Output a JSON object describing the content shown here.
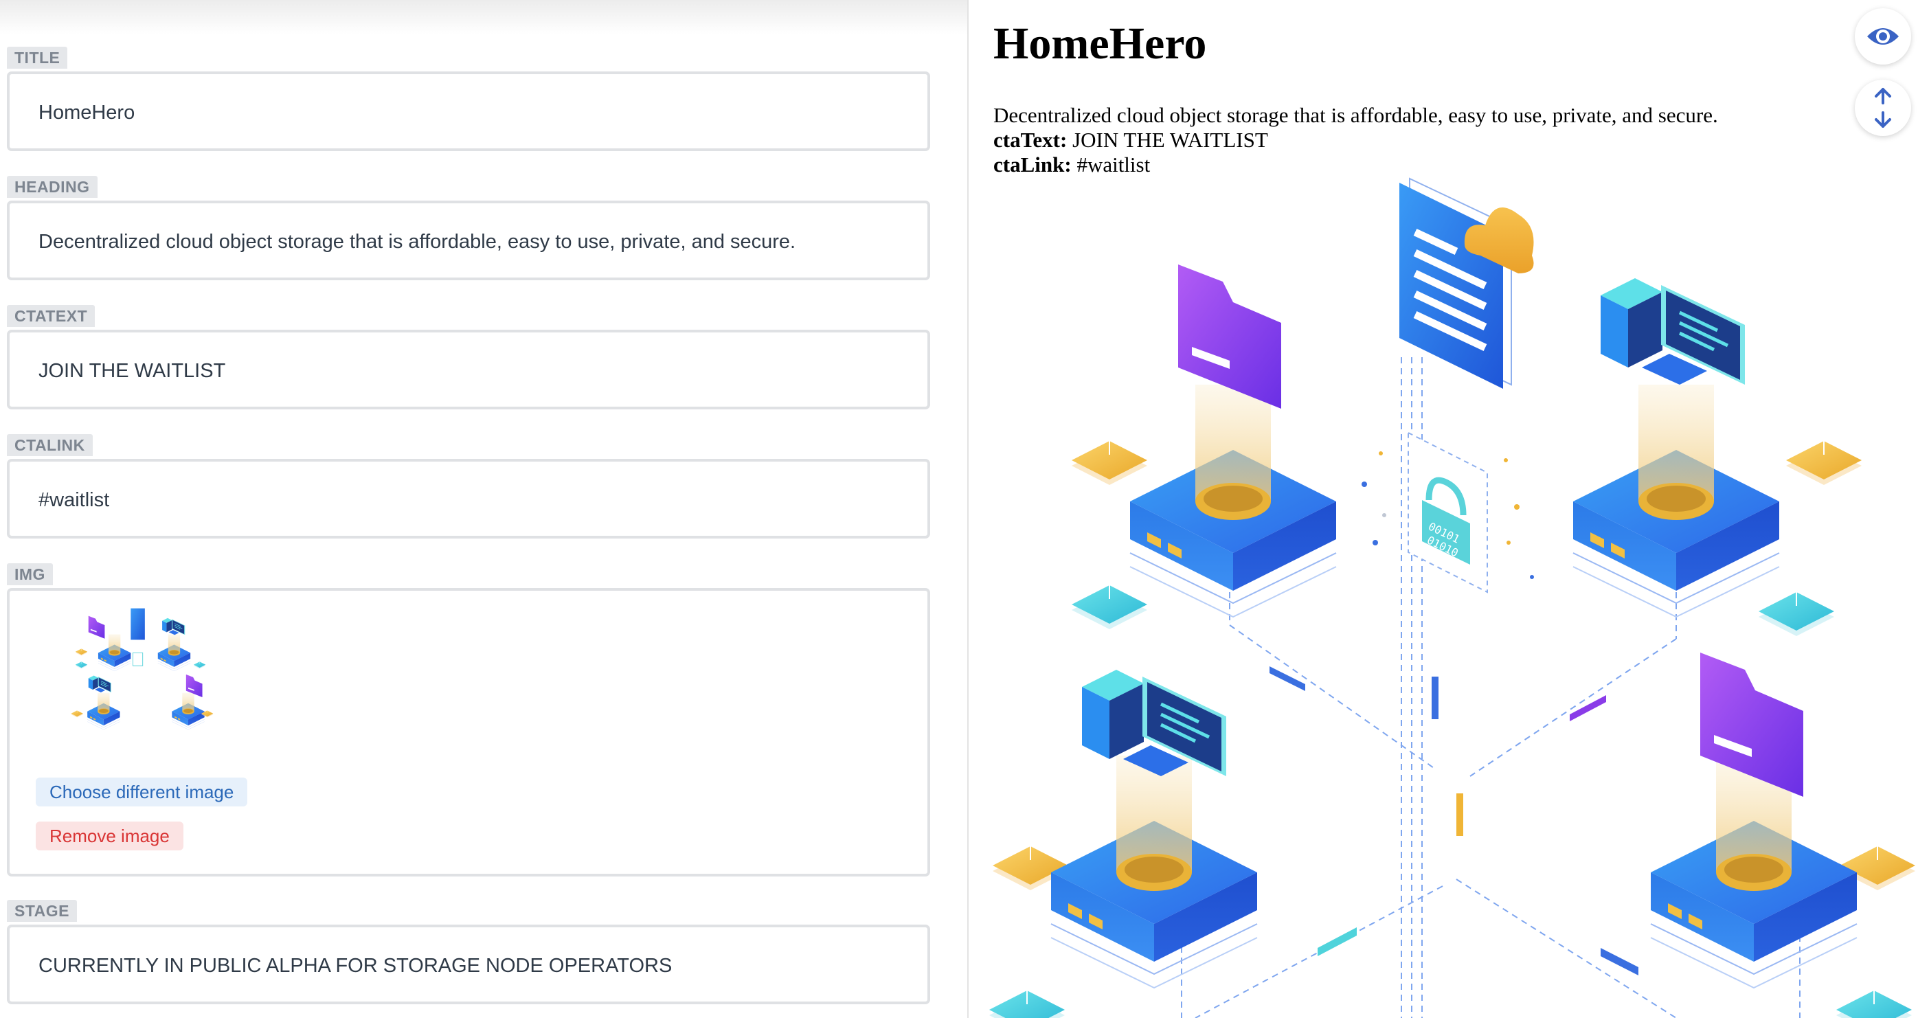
{
  "editor": {
    "fields": [
      {
        "label": "TITLE",
        "value": "HomeHero"
      },
      {
        "label": "HEADING",
        "value": "Decentralized cloud object storage that is affordable, easy to use, private, and secure."
      },
      {
        "label": "CTATEXT",
        "value": "JOIN THE WAITLIST"
      },
      {
        "label": "CTALINK",
        "value": "#waitlist"
      },
      {
        "label": "IMG"
      },
      {
        "label": "STAGE",
        "value": "CURRENTLY IN PUBLIC ALPHA FOR STORAGE NODE OPERATORS"
      }
    ],
    "image_actions": {
      "choose": "Choose different image",
      "remove": "Remove image"
    }
  },
  "preview": {
    "title": "HomeHero",
    "heading": "Decentralized cloud object storage that is affordable, easy to use, private, and secure.",
    "cta_text_label": "ctaText:",
    "cta_text": "JOIN THE WAITLIST",
    "cta_link_label": "ctaLink:",
    "cta_link": "#waitlist",
    "lock_code": [
      "00101",
      "01010"
    ]
  },
  "toolbar": {
    "preview_icon": "eye-icon",
    "expand_icon": "vertical-arrows-icon"
  },
  "colors": {
    "accent_blue": "#3a6fe0",
    "label_bg": "#e5e7ea",
    "remove_red": "#d93535"
  }
}
